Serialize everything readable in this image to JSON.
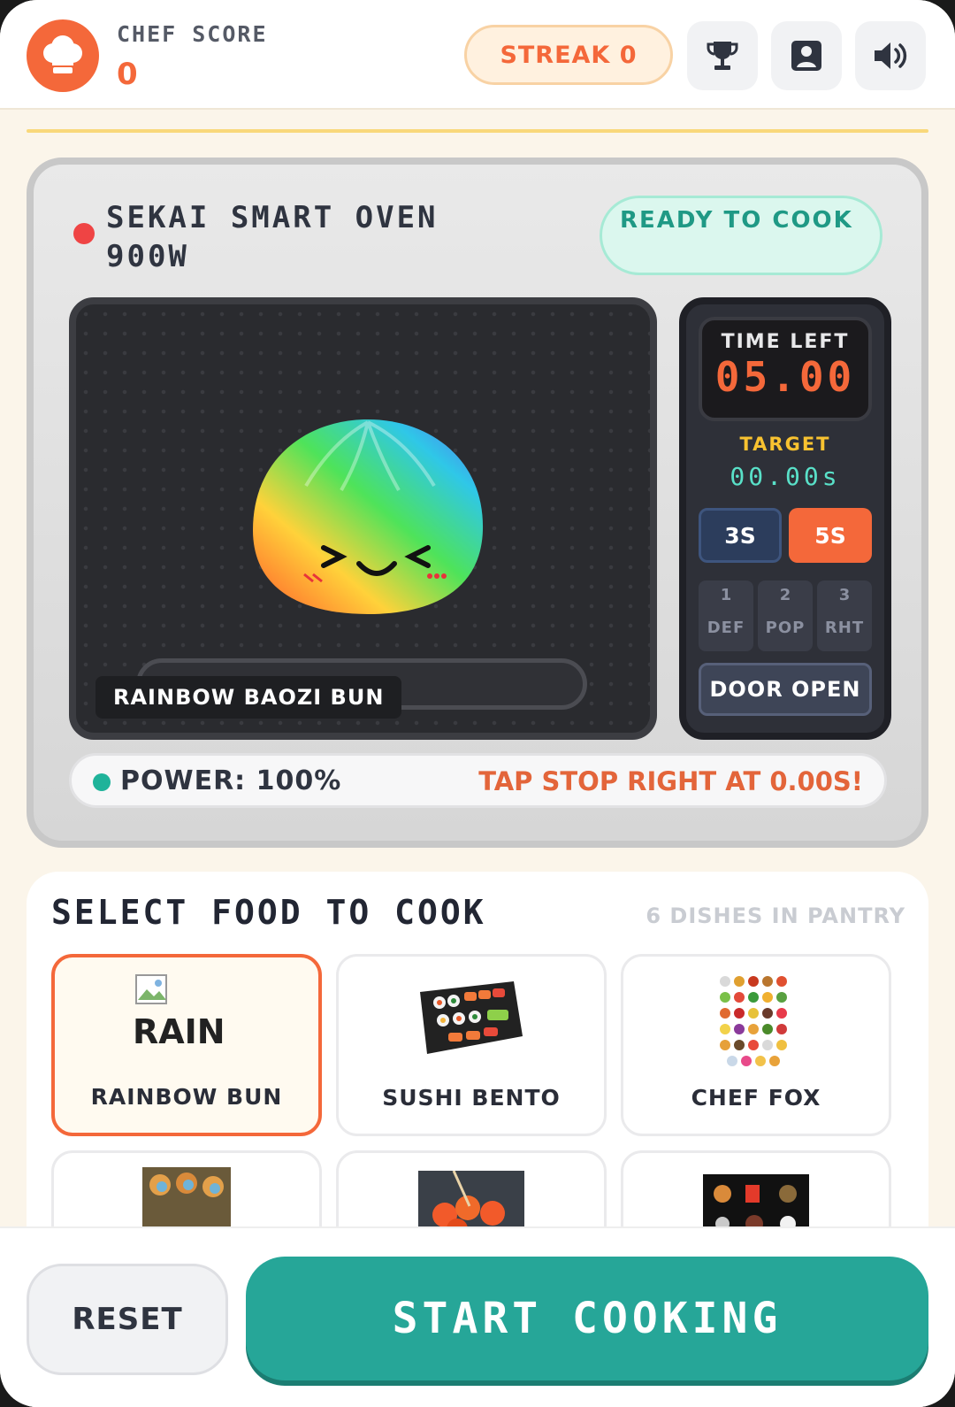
{
  "header": {
    "score_label": "CHEF SCORE",
    "score_value": "0",
    "streak_label": "STREAK 0",
    "buttons": [
      "trophy-icon",
      "profile-icon",
      "speaker-icon"
    ]
  },
  "oven": {
    "title": "SEKAI SMART OVEN 900W",
    "status": "READY TO COOK",
    "dish_tag": "RAINBOW BAOZI BUN",
    "cook_progress": 0,
    "time_left_label": "TIME LEFT",
    "time_left_value": "05.00",
    "target_label": "TARGET",
    "target_value": "00.00s",
    "time_options": [
      {
        "label": "3S",
        "selected": false
      },
      {
        "label": "5S",
        "selected": true
      }
    ],
    "modes": [
      {
        "num": "1",
        "label": "DEF"
      },
      {
        "num": "2",
        "label": "POP"
      },
      {
        "num": "3",
        "label": "RHT"
      }
    ],
    "door_label": "DOOR OPEN",
    "power_label": "POWER: 100%",
    "hint": "TAP STOP RIGHT AT 0.00S!"
  },
  "food": {
    "title": "SELECT FOOD TO COOK",
    "pantry": "6 DISHES IN PANTRY",
    "items": [
      {
        "name": "RAINBOW BUN",
        "selected": true,
        "broken_alt": "RAIN"
      },
      {
        "name": "SUSHI BENTO",
        "selected": false
      },
      {
        "name": "CHEF FOX",
        "selected": false
      },
      {
        "name": "",
        "selected": false
      },
      {
        "name": "",
        "selected": false
      },
      {
        "name": "",
        "selected": false
      }
    ]
  },
  "footer": {
    "reset_label": "RESET",
    "start_label": "START COOKING"
  },
  "colors": {
    "accent": "#f4683a",
    "teal": "#26a698",
    "warning_dot": "#ef4444"
  }
}
